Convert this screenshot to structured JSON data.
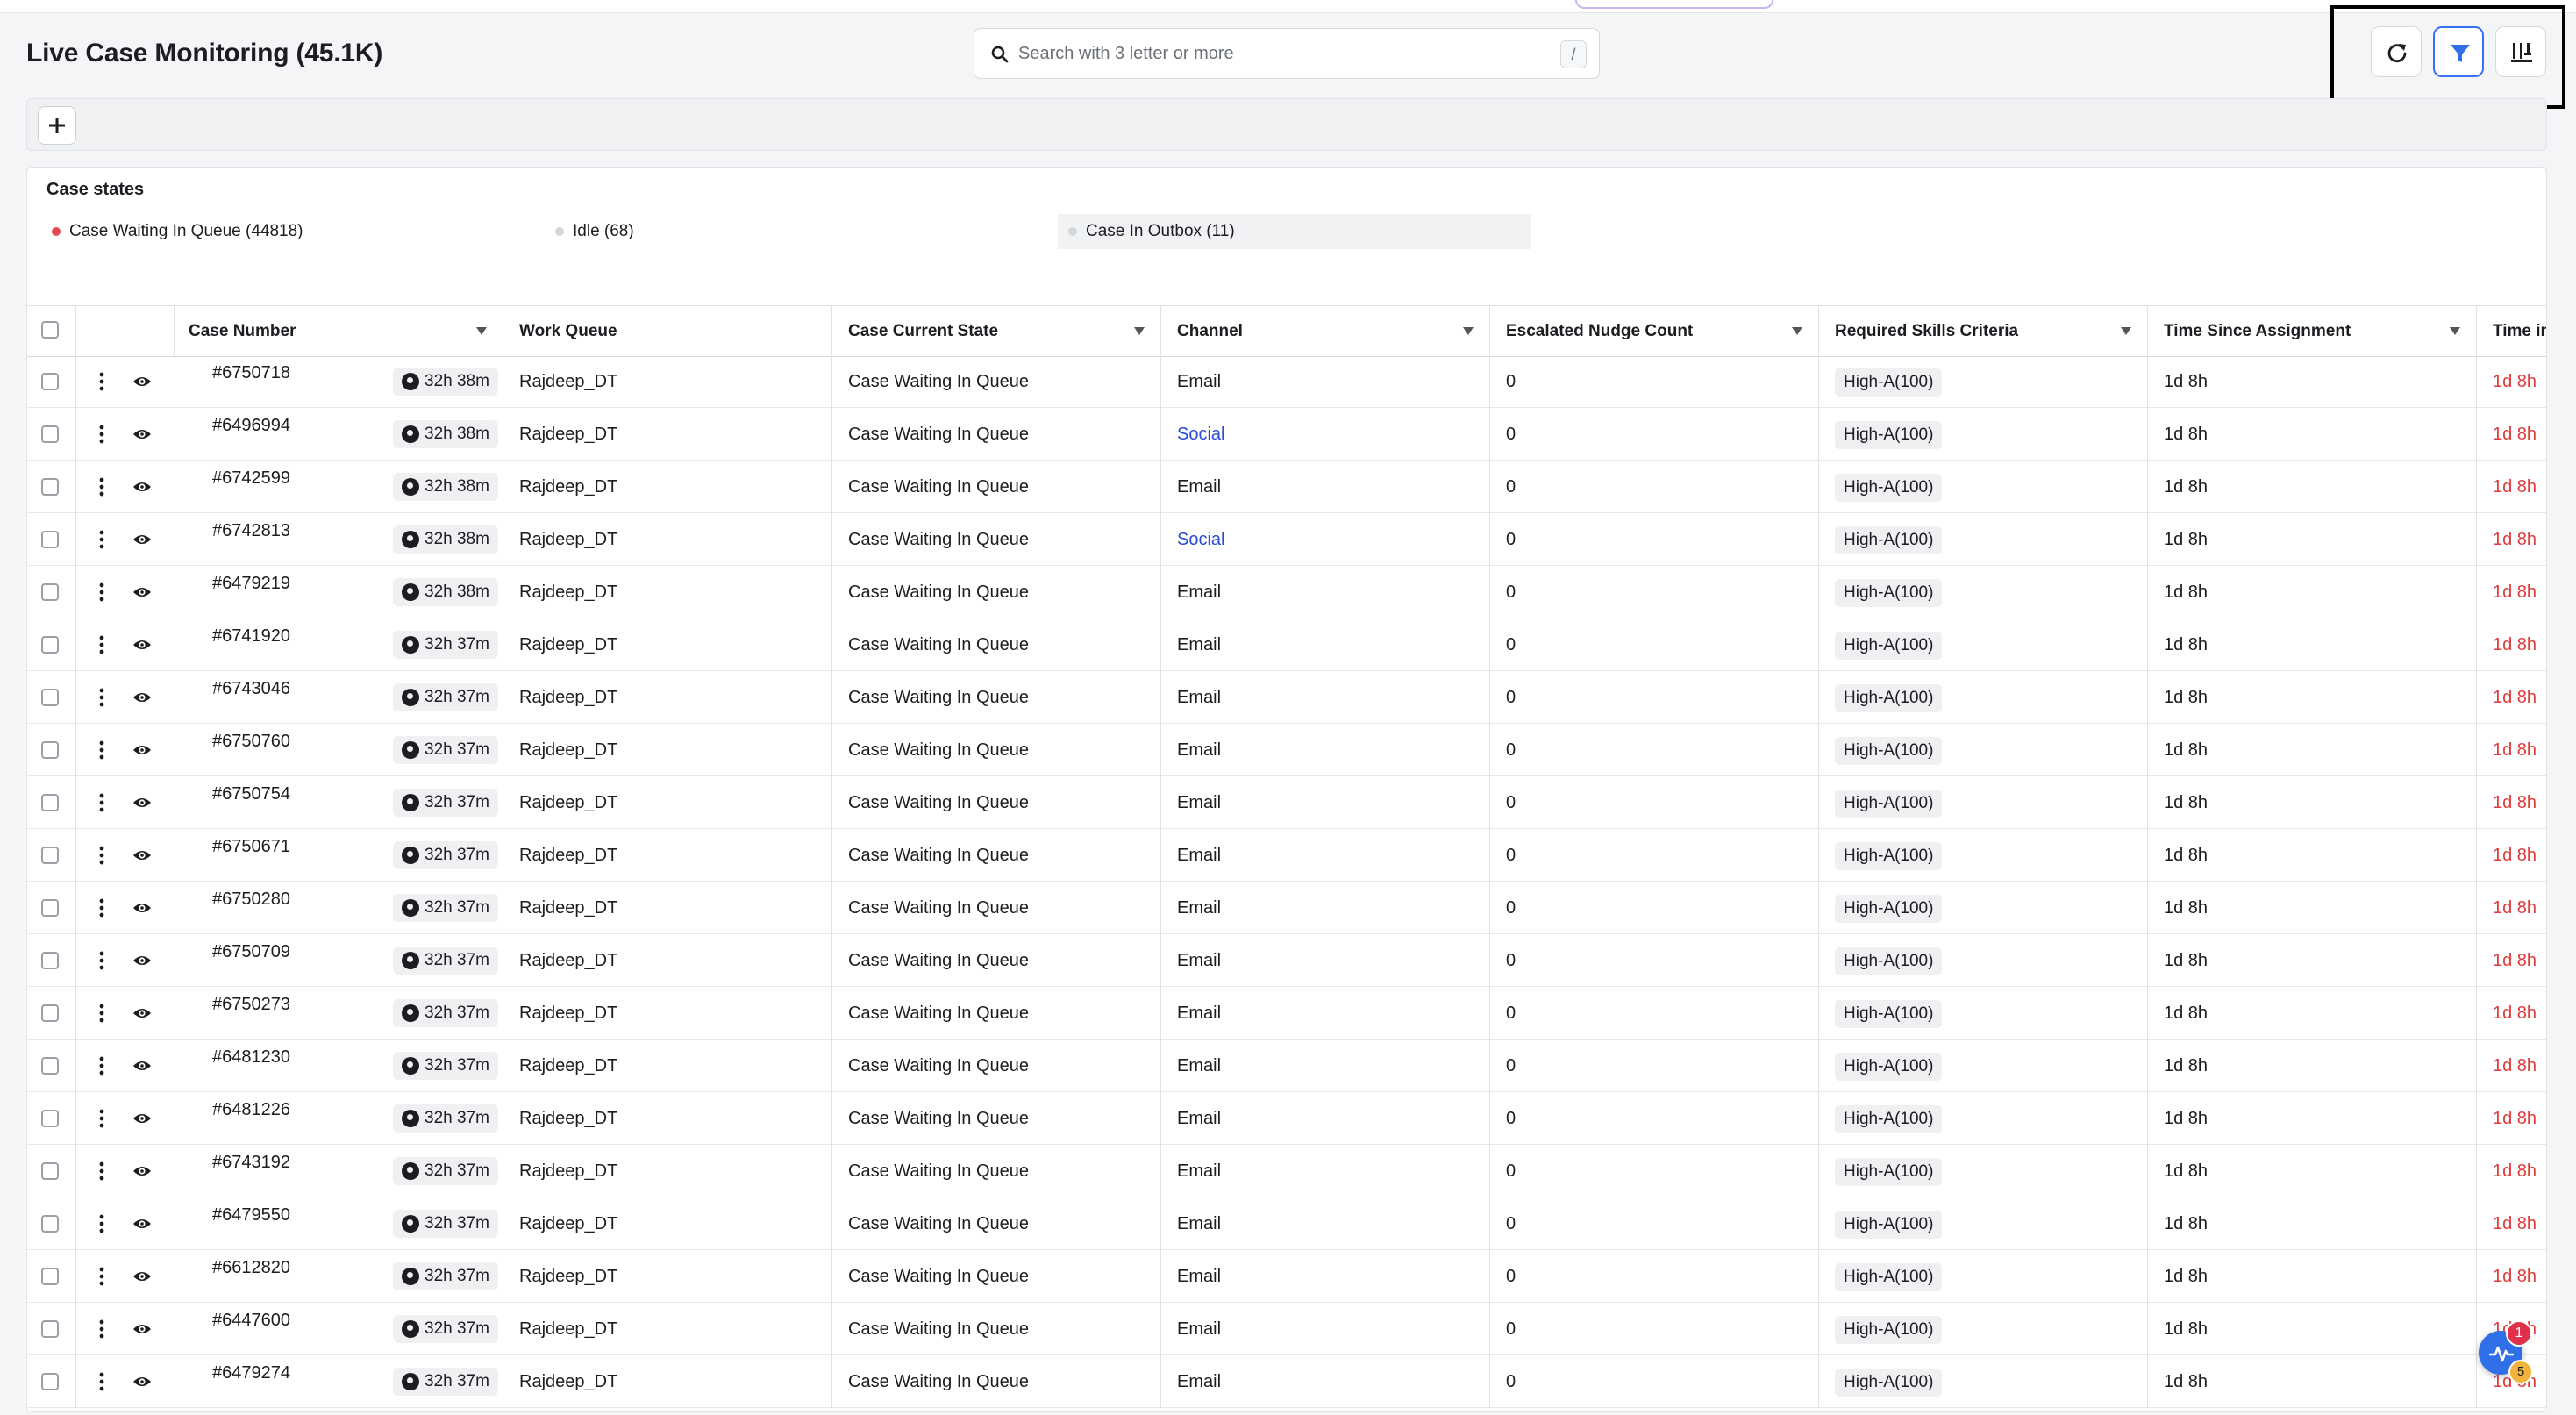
{
  "page": {
    "title": "Live Case Monitoring (45.1K)"
  },
  "search": {
    "placeholder": "Search with 3 letter or more",
    "shortcut": "/"
  },
  "toolbar": {
    "refresh_icon": "refresh-icon",
    "filter_icon": "filter-icon",
    "columns_icon": "columns-icon"
  },
  "case_states": {
    "title": "Case states",
    "items": [
      {
        "label": "Case Waiting In Queue (44818)",
        "color": "#e5484d"
      },
      {
        "label": "Idle (68)",
        "color": "#d3d6da"
      },
      {
        "label": "Case In Outbox (11)",
        "color": "#d3d6da"
      }
    ]
  },
  "table": {
    "columns": [
      "Case Number",
      "Work Queue",
      "Case Current State",
      "Channel",
      "Escalated Nudge Count",
      "Required Skills Criteria",
      "Time Since Assignment",
      "Time in"
    ],
    "rows": [
      {
        "case": "#6750718",
        "timer": "32h 38m",
        "queue": "Rajdeep_DT",
        "state": "Case Waiting In Queue",
        "channel": "Email",
        "nudge": "0",
        "skills": "High-A(100)",
        "since": "1d 8h",
        "timein": "1d 8h"
      },
      {
        "case": "#6496994",
        "timer": "32h 38m",
        "queue": "Rajdeep_DT",
        "state": "Case Waiting In Queue",
        "channel": "Social",
        "nudge": "0",
        "skills": "High-A(100)",
        "since": "1d 8h",
        "timein": "1d 8h"
      },
      {
        "case": "#6742599",
        "timer": "32h 38m",
        "queue": "Rajdeep_DT",
        "state": "Case Waiting In Queue",
        "channel": "Email",
        "nudge": "0",
        "skills": "High-A(100)",
        "since": "1d 8h",
        "timein": "1d 8h"
      },
      {
        "case": "#6742813",
        "timer": "32h 38m",
        "queue": "Rajdeep_DT",
        "state": "Case Waiting In Queue",
        "channel": "Social",
        "nudge": "0",
        "skills": "High-A(100)",
        "since": "1d 8h",
        "timein": "1d 8h"
      },
      {
        "case": "#6479219",
        "timer": "32h 38m",
        "queue": "Rajdeep_DT",
        "state": "Case Waiting In Queue",
        "channel": "Email",
        "nudge": "0",
        "skills": "High-A(100)",
        "since": "1d 8h",
        "timein": "1d 8h"
      },
      {
        "case": "#6741920",
        "timer": "32h 37m",
        "queue": "Rajdeep_DT",
        "state": "Case Waiting In Queue",
        "channel": "Email",
        "nudge": "0",
        "skills": "High-A(100)",
        "since": "1d 8h",
        "timein": "1d 8h"
      },
      {
        "case": "#6743046",
        "timer": "32h 37m",
        "queue": "Rajdeep_DT",
        "state": "Case Waiting In Queue",
        "channel": "Email",
        "nudge": "0",
        "skills": "High-A(100)",
        "since": "1d 8h",
        "timein": "1d 8h"
      },
      {
        "case": "#6750760",
        "timer": "32h 37m",
        "queue": "Rajdeep_DT",
        "state": "Case Waiting In Queue",
        "channel": "Email",
        "nudge": "0",
        "skills": "High-A(100)",
        "since": "1d 8h",
        "timein": "1d 8h"
      },
      {
        "case": "#6750754",
        "timer": "32h 37m",
        "queue": "Rajdeep_DT",
        "state": "Case Waiting In Queue",
        "channel": "Email",
        "nudge": "0",
        "skills": "High-A(100)",
        "since": "1d 8h",
        "timein": "1d 8h"
      },
      {
        "case": "#6750671",
        "timer": "32h 37m",
        "queue": "Rajdeep_DT",
        "state": "Case Waiting In Queue",
        "channel": "Email",
        "nudge": "0",
        "skills": "High-A(100)",
        "since": "1d 8h",
        "timein": "1d 8h"
      },
      {
        "case": "#6750280",
        "timer": "32h 37m",
        "queue": "Rajdeep_DT",
        "state": "Case Waiting In Queue",
        "channel": "Email",
        "nudge": "0",
        "skills": "High-A(100)",
        "since": "1d 8h",
        "timein": "1d 8h"
      },
      {
        "case": "#6750709",
        "timer": "32h 37m",
        "queue": "Rajdeep_DT",
        "state": "Case Waiting In Queue",
        "channel": "Email",
        "nudge": "0",
        "skills": "High-A(100)",
        "since": "1d 8h",
        "timein": "1d 8h"
      },
      {
        "case": "#6750273",
        "timer": "32h 37m",
        "queue": "Rajdeep_DT",
        "state": "Case Waiting In Queue",
        "channel": "Email",
        "nudge": "0",
        "skills": "High-A(100)",
        "since": "1d 8h",
        "timein": "1d 8h"
      },
      {
        "case": "#6481230",
        "timer": "32h 37m",
        "queue": "Rajdeep_DT",
        "state": "Case Waiting In Queue",
        "channel": "Email",
        "nudge": "0",
        "skills": "High-A(100)",
        "since": "1d 8h",
        "timein": "1d 8h"
      },
      {
        "case": "#6481226",
        "timer": "32h 37m",
        "queue": "Rajdeep_DT",
        "state": "Case Waiting In Queue",
        "channel": "Email",
        "nudge": "0",
        "skills": "High-A(100)",
        "since": "1d 8h",
        "timein": "1d 8h"
      },
      {
        "case": "#6743192",
        "timer": "32h 37m",
        "queue": "Rajdeep_DT",
        "state": "Case Waiting In Queue",
        "channel": "Email",
        "nudge": "0",
        "skills": "High-A(100)",
        "since": "1d 8h",
        "timein": "1d 8h"
      },
      {
        "case": "#6479550",
        "timer": "32h 37m",
        "queue": "Rajdeep_DT",
        "state": "Case Waiting In Queue",
        "channel": "Email",
        "nudge": "0",
        "skills": "High-A(100)",
        "since": "1d 8h",
        "timein": "1d 8h"
      },
      {
        "case": "#6612820",
        "timer": "32h 37m",
        "queue": "Rajdeep_DT",
        "state": "Case Waiting In Queue",
        "channel": "Email",
        "nudge": "0",
        "skills": "High-A(100)",
        "since": "1d 8h",
        "timein": "1d 8h"
      },
      {
        "case": "#6447600",
        "timer": "32h 37m",
        "queue": "Rajdeep_DT",
        "state": "Case Waiting In Queue",
        "channel": "Email",
        "nudge": "0",
        "skills": "High-A(100)",
        "since": "1d 8h",
        "timein": "1d 8h"
      },
      {
        "case": "#6479274",
        "timer": "32h 37m",
        "queue": "Rajdeep_DT",
        "state": "Case Waiting In Queue",
        "channel": "Email",
        "nudge": "0",
        "skills": "High-A(100)",
        "since": "1d 8h",
        "timein": "1d 8h"
      }
    ]
  },
  "colors": {
    "accent": "#2f6fe8",
    "social_link": "#2a4bd7",
    "overdue": "#e03a3a"
  },
  "widget": {
    "icon": "activity-icon",
    "badge_top": "1",
    "badge_bottom": "5"
  }
}
